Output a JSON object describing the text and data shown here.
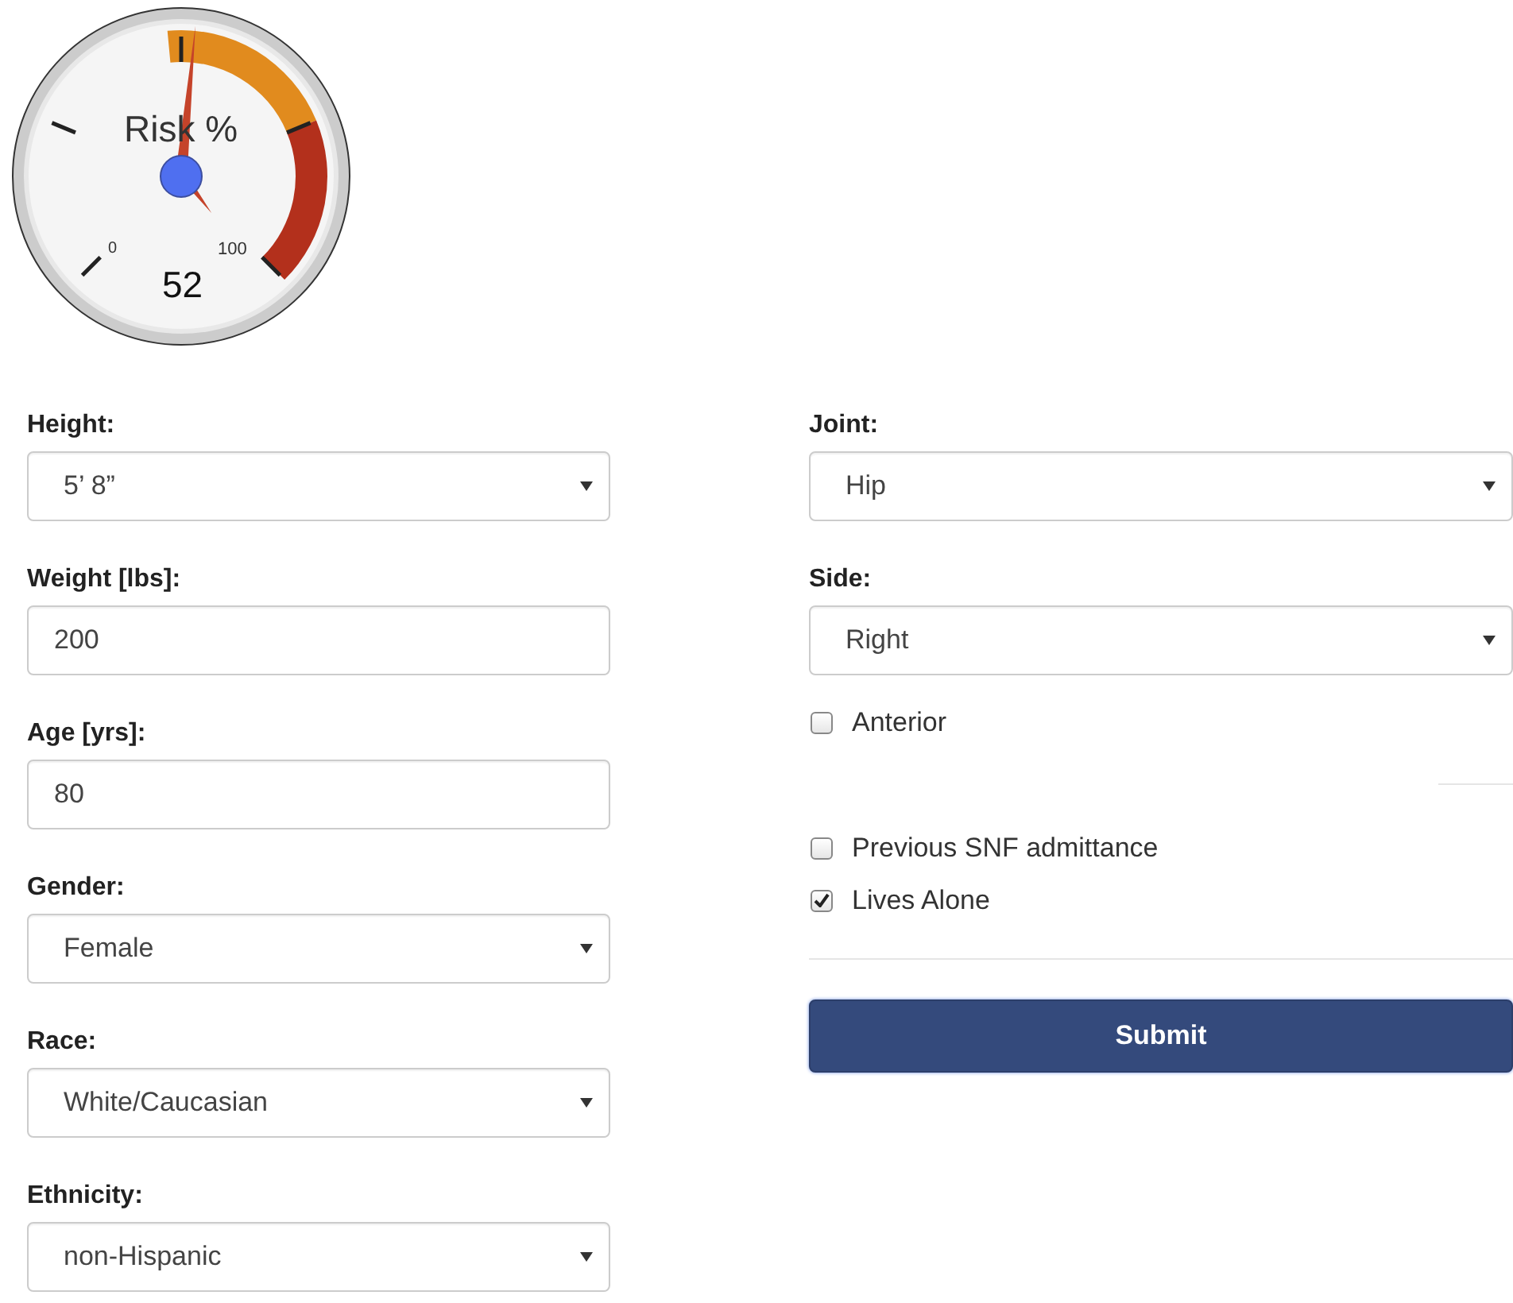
{
  "gauge": {
    "title": "Risk %",
    "min_label": "0",
    "max_label": "100",
    "value": "52",
    "level": 0.52
  },
  "left_fields": [
    {
      "kind": "select",
      "label": "Height:",
      "value": "5’ 8”"
    },
    {
      "kind": "input",
      "label": "Weight [lbs]:",
      "value": "200"
    },
    {
      "kind": "input",
      "label": "Age [yrs]:",
      "value": "80"
    },
    {
      "kind": "select",
      "label": "Gender:",
      "value": "Female"
    },
    {
      "kind": "select",
      "label": "Race:",
      "value": "White/Caucasian"
    },
    {
      "kind": "select",
      "label": "Ethnicity:",
      "value": "non-Hispanic"
    }
  ],
  "right_fields": [
    {
      "kind": "select",
      "label": "Joint:",
      "value": "Hip"
    },
    {
      "kind": "select",
      "label": "Side:",
      "value": "Right"
    }
  ],
  "anterior": {
    "label": "Anterior",
    "checked": false
  },
  "checkboxes": [
    {
      "label": "Previous SNF admittance",
      "checked": false
    },
    {
      "label": "Lives Alone",
      "checked": true
    }
  ],
  "submit": "Submit"
}
